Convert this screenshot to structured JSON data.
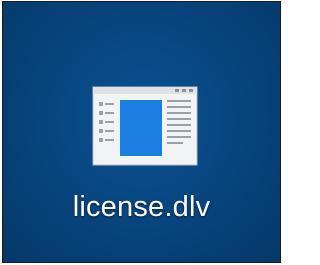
{
  "desktop": {
    "background_color": "#084681",
    "icon": {
      "label": "license.dlv",
      "icon_name": "document-window-icon",
      "accent_color": "#1a7fe0"
    }
  }
}
